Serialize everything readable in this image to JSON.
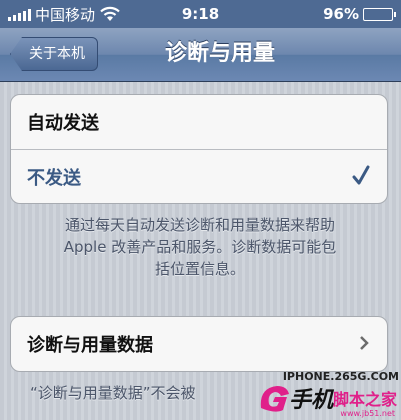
{
  "status_bar": {
    "carrier": "中国移动",
    "time": "9:18",
    "battery": "96%",
    "battery_level": 0.96,
    "icons": [
      "signal-icon",
      "wifi-icon",
      "battery-icon"
    ]
  },
  "nav": {
    "back_label": "关于本机",
    "title": "诊断与用量"
  },
  "options": [
    {
      "label": "自动发送",
      "selected": false
    },
    {
      "label": "不发送",
      "selected": true
    }
  ],
  "description": [
    "通过每天自动发送诊断和用量数据来帮助",
    "Apple 改善产品和服务。诊断数据可能包",
    "括位置信息。"
  ],
  "data_row": {
    "label": "诊断与用量数据"
  },
  "footer_partial": "“诊断与用量数据”不会被",
  "watermark": {
    "top": "IPHONE.265G.COM",
    "main": "手机",
    "cn": "脚本之家",
    "url": "www.jb51.net"
  },
  "colors": {
    "nav_blue": "#6d87ae",
    "status_bg": "#4e6a93",
    "check_blue": "#3b5a84"
  }
}
